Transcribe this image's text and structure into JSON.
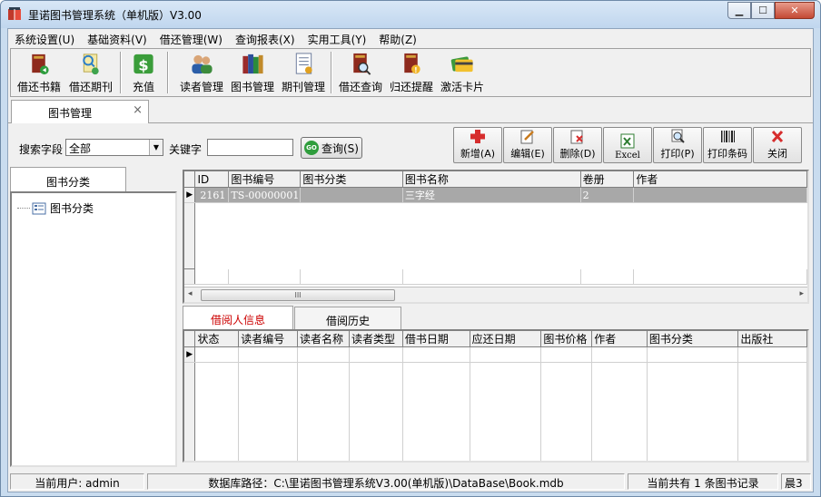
{
  "window": {
    "title": "里诺图书管理系统（单机版）V3.00",
    "controls": [
      "minimize",
      "maximize",
      "close"
    ]
  },
  "menu": [
    "系统设置(U)",
    "基础资料(V)",
    "借还管理(W)",
    "查询报表(X)",
    "实用工具(Y)",
    "帮助(Z)"
  ],
  "toolbar": [
    {
      "label": "借还书籍",
      "icon": "book-return-icon"
    },
    {
      "label": "借还期刊",
      "icon": "periodical-icon"
    },
    {
      "label": "充值",
      "icon": "dollar-icon"
    },
    {
      "label": "读者管理",
      "icon": "readers-icon"
    },
    {
      "label": "图书管理",
      "icon": "books-icon"
    },
    {
      "label": "期刊管理",
      "icon": "journal-icon"
    },
    {
      "label": "借还查询",
      "icon": "search-book-icon"
    },
    {
      "label": "归还提醒",
      "icon": "reminder-icon"
    },
    {
      "label": "激活卡片",
      "icon": "card-icon"
    }
  ],
  "doc_tab": {
    "label": "图书管理",
    "close": "×"
  },
  "search": {
    "field_label": "搜索字段",
    "field_value": "全部",
    "keyword_label": "关键字",
    "keyword_value": "",
    "query_button": "查询(S)",
    "go_icon_text": "GO"
  },
  "actions": [
    {
      "label": "新增(A)",
      "icon": "add-icon"
    },
    {
      "label": "编辑(E)",
      "icon": "edit-icon"
    },
    {
      "label": "删除(D)",
      "icon": "delete-icon"
    },
    {
      "label": "Excel",
      "icon": "excel-icon"
    },
    {
      "label": "打印(P)",
      "icon": "print-icon"
    },
    {
      "label": "打印条码",
      "icon": "barcode-icon"
    },
    {
      "label": "关闭",
      "icon": "close-icon"
    }
  ],
  "left_panel": {
    "tab": "图书分类",
    "tree": [
      {
        "label": "图书分类",
        "icon": "category-icon"
      }
    ]
  },
  "books_table": {
    "columns": [
      "ID",
      "图书编号",
      "图书分类",
      "图书名称",
      "卷册",
      "作者"
    ],
    "rows": [
      {
        "ID": "2161",
        "图书编号": "TS-00000001",
        "图书分类": "",
        "图书名称": "三字经",
        "卷册": "2",
        "作者": ""
      }
    ],
    "scroll_thumb_text": "III"
  },
  "sub_tabs": [
    {
      "label": "借阅人信息",
      "active": true
    },
    {
      "label": "借阅历史",
      "active": false
    }
  ],
  "borrow_table": {
    "columns": [
      "状态",
      "读者编号",
      "读者名称",
      "读者类型",
      "借书日期",
      "应还日期",
      "图书价格",
      "作者",
      "图书分类",
      "出版社"
    ],
    "rows": []
  },
  "status": {
    "user": "当前用户: admin",
    "db_path": "数据库路径：C:\\里诺图书管理系统V3.00(单机版)\\DataBase\\Book.mdb",
    "record_count": "当前共有 1 条图书记录",
    "extra": "晨3"
  },
  "colors": {
    "title_bg": "#c9dcef",
    "selected_row": "#a8a8a8",
    "active_subtab_text": "#cc0000",
    "close_button": "#c44934"
  }
}
